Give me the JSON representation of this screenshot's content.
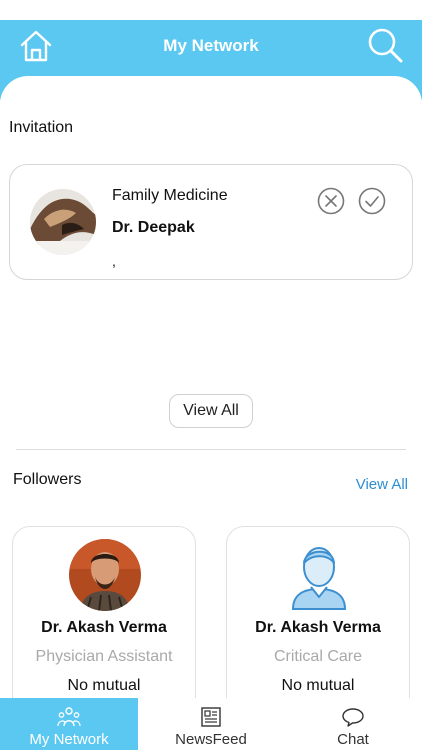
{
  "header": {
    "title": "My Network",
    "home_icon": "home-icon",
    "search_icon": "search-icon",
    "color": "#5bc8f2"
  },
  "invitation": {
    "section_title": "Invitation",
    "specialty": "Family Medicine",
    "name": "Dr. Deepak",
    "extra": ",",
    "reject_icon": "close-circle-icon",
    "accept_icon": "check-circle-icon",
    "view_all_label": "View All"
  },
  "followers": {
    "section_title": "Followers",
    "view_all_label": "View All",
    "items": [
      {
        "name": "Dr. Akash Verma",
        "role": "Physician Assistant",
        "mutual": "No mutual"
      },
      {
        "name": "Dr. Akash Verma",
        "role": "Critical Care",
        "mutual": "No mutual"
      }
    ]
  },
  "tabbar": {
    "tabs": [
      {
        "label": "My Network",
        "icon": "network-icon",
        "active": true
      },
      {
        "label": "NewsFeed",
        "icon": "newspaper-icon",
        "active": false
      },
      {
        "label": "Chat",
        "icon": "chat-bubble-icon",
        "active": false
      }
    ]
  },
  "colors": {
    "accent": "#5bc8f2",
    "link": "#2b8fd6",
    "muted": "#a9a9a9"
  }
}
